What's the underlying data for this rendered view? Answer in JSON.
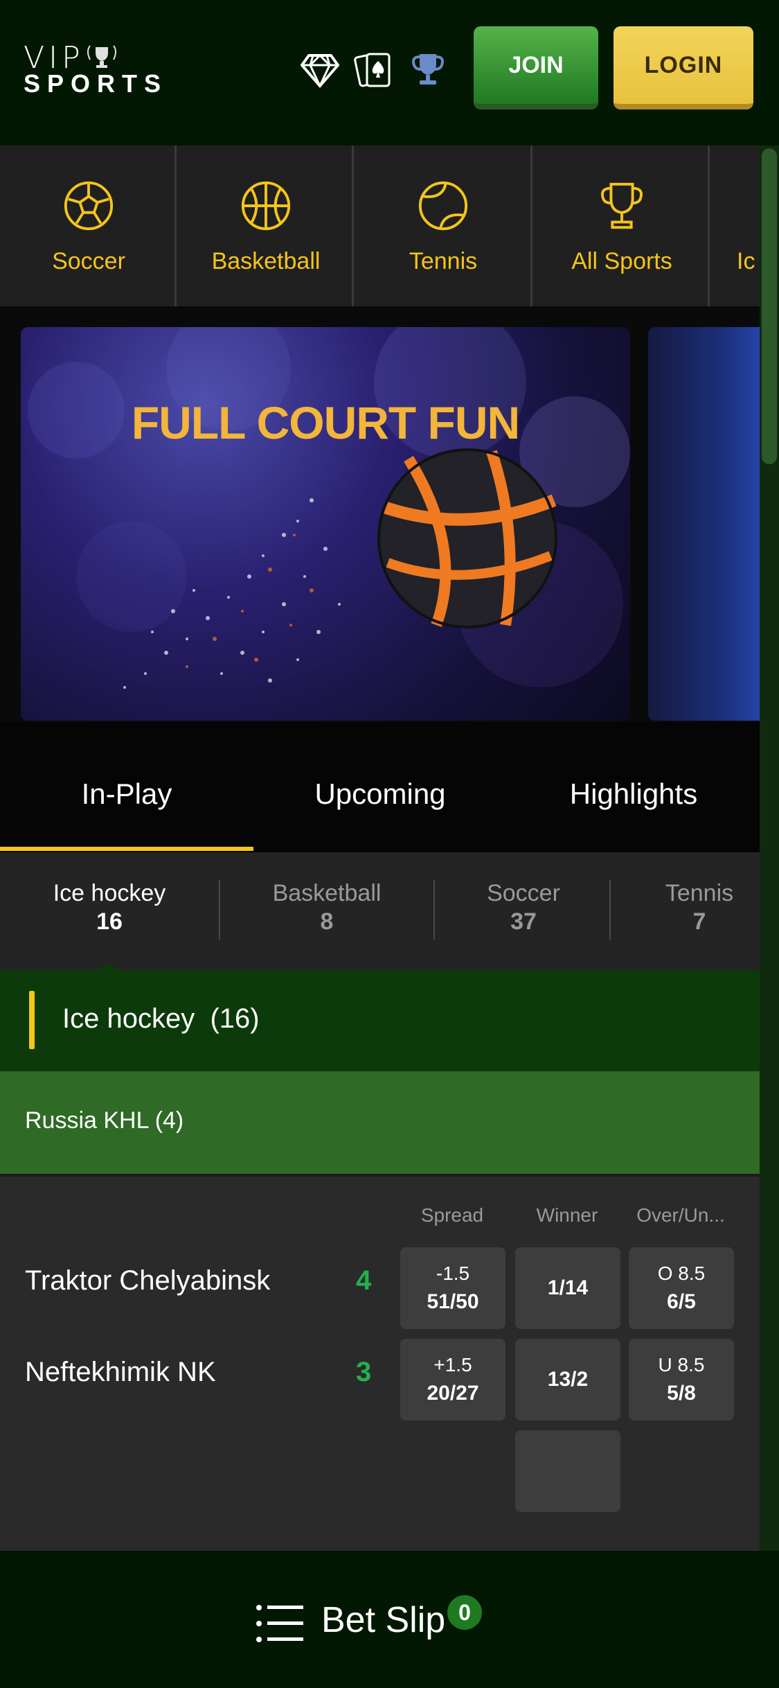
{
  "header": {
    "logo_top": "VIP",
    "logo_bottom": "SPORTS",
    "join_label": "JOIN",
    "login_label": "LOGIN"
  },
  "categories": [
    {
      "label": "Soccer",
      "icon": "soccer-ball-icon"
    },
    {
      "label": "Basketball",
      "icon": "basketball-icon"
    },
    {
      "label": "Tennis",
      "icon": "tennis-ball-icon"
    },
    {
      "label": "All Sports",
      "icon": "trophy-icon"
    },
    {
      "label": "Ic",
      "icon": ""
    }
  ],
  "banner": {
    "title": "FULL COURT FUN"
  },
  "tabs": [
    "In-Play",
    "Upcoming",
    "Highlights"
  ],
  "filters": [
    {
      "name": "Ice hockey",
      "count": "16"
    },
    {
      "name": "Basketball",
      "count": "8"
    },
    {
      "name": "Soccer",
      "count": "37"
    },
    {
      "name": "Tennis",
      "count": "7"
    }
  ],
  "group": {
    "title": "Ice hockey  (16)"
  },
  "league": {
    "title": "Russia KHL (4)"
  },
  "match": {
    "columns": [
      "Spread",
      "Winner",
      "Over/Un..."
    ],
    "teams": [
      {
        "name": "Traktor Chelyabinsk",
        "score": "4",
        "spread": {
          "line": "-1.5",
          "odds": "51/50"
        },
        "winner": "1/14",
        "total": {
          "line": "O 8.5",
          "odds": "6/5"
        }
      },
      {
        "name": "Neftekhimik NK",
        "score": "3",
        "spread": {
          "line": "+1.5",
          "odds": "20/27"
        },
        "winner": "13/2",
        "total": {
          "line": "U 8.5",
          "odds": "5/8"
        }
      }
    ]
  },
  "betslip": {
    "label": "Bet Slip",
    "count": "0"
  },
  "colors": {
    "accent": "#f5c518",
    "join_green": "#2f8a2a",
    "score_green": "#22b14c",
    "header_bg": "#021802"
  }
}
